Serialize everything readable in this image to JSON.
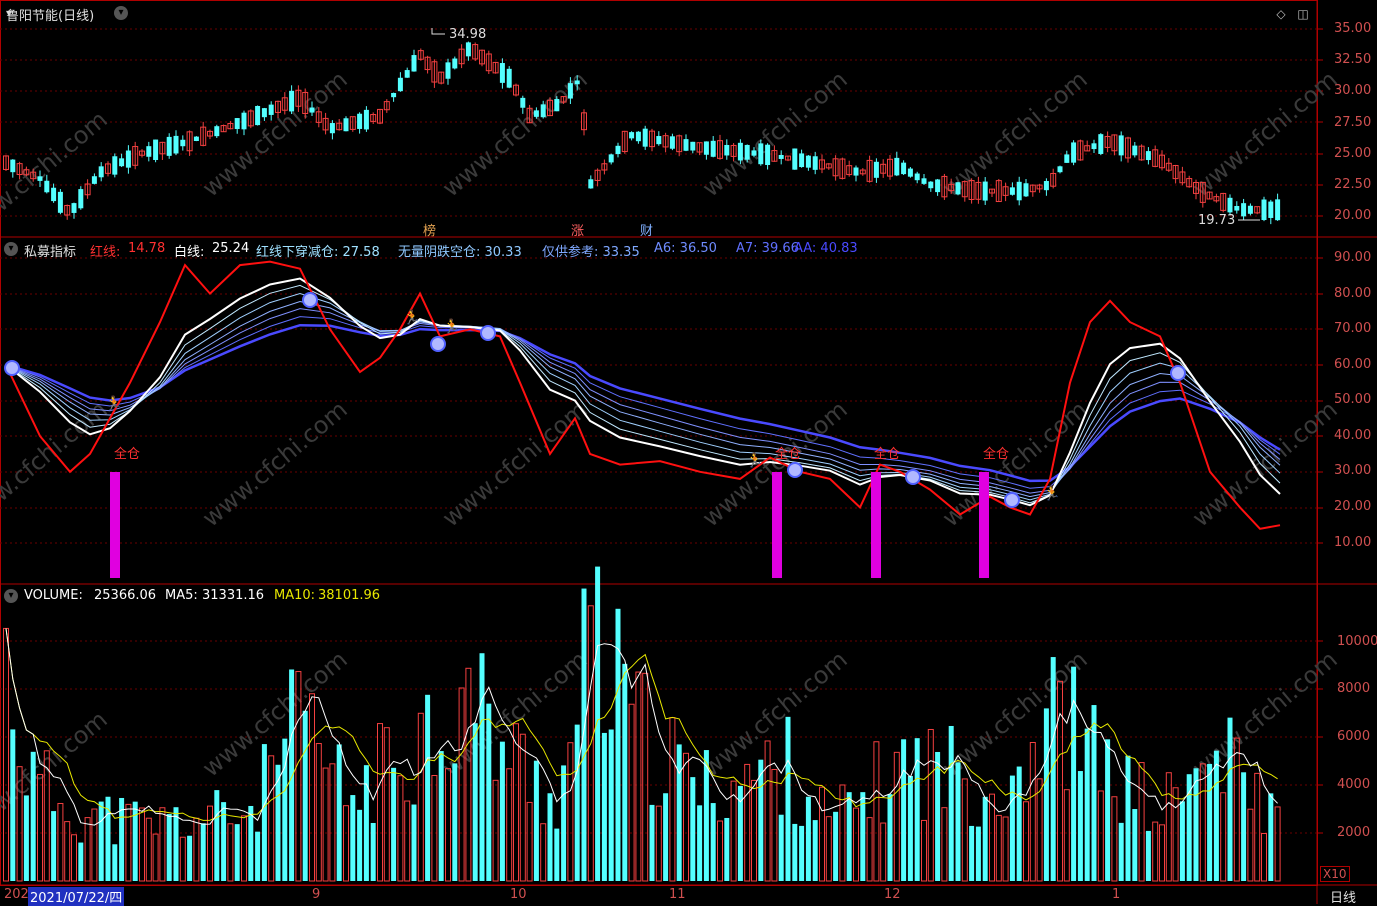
{
  "colors": {
    "up": "#f44040",
    "down": "#54ffff",
    "frame": "#b00000",
    "bg": "#000000",
    "white": "#ffffff",
    "magenta": "#e000e0",
    "yellow": "#e8e800",
    "blue": "#5050ff"
  },
  "header": {
    "title": "鲁阳节能(日线)"
  },
  "price_panel": {
    "high_label": "34.98",
    "low_label": "19.73",
    "markers": [
      {
        "text": "榜",
        "color": "#e0a050"
      },
      {
        "text": "涨",
        "color": "#ff6060"
      },
      {
        "text": "财",
        "color": "#80b0ff"
      }
    ],
    "ticks": [
      "35.00",
      "32.50",
      "30.00",
      "27.50",
      "25.00",
      "22.50",
      "20.00"
    ]
  },
  "indicator_panel": {
    "name": "私募指标",
    "red_label": "红线:",
    "red_value": "14.78",
    "white_label": "白线:",
    "white_value": "25.24",
    "cross_text": "红线下穿减仓: 27.58",
    "neg_text": "无量阴跌空仓: 30.33",
    "ref_text": "仅供参考: 33.35",
    "a6_text": "A6: 36.50",
    "a7_text": "A7: 39.66",
    "aa_text": "AA: 40.83",
    "signal_label": "全仓",
    "ticks": [
      "90.00",
      "80.00",
      "70.00",
      "60.00",
      "50.00",
      "40.00",
      "30.00",
      "20.00",
      "10.00"
    ]
  },
  "volume_panel": {
    "vol_label": "VOLUME:",
    "vol_value": "25366.06",
    "ma5_label": "MA5:",
    "ma5_value": "31331.16",
    "ma10_label": "MA10:",
    "ma10_value": "38101.96",
    "ticks": [
      "10000",
      "8000",
      "6000",
      "4000",
      "2000"
    ],
    "unit": "X10"
  },
  "date_axis": {
    "start": "202",
    "cursor_date": "2021/07/22/四",
    "months": [
      "9",
      "10",
      "11",
      "12",
      "1"
    ],
    "period": "日线"
  },
  "watermark": "www.cfchi.com"
}
